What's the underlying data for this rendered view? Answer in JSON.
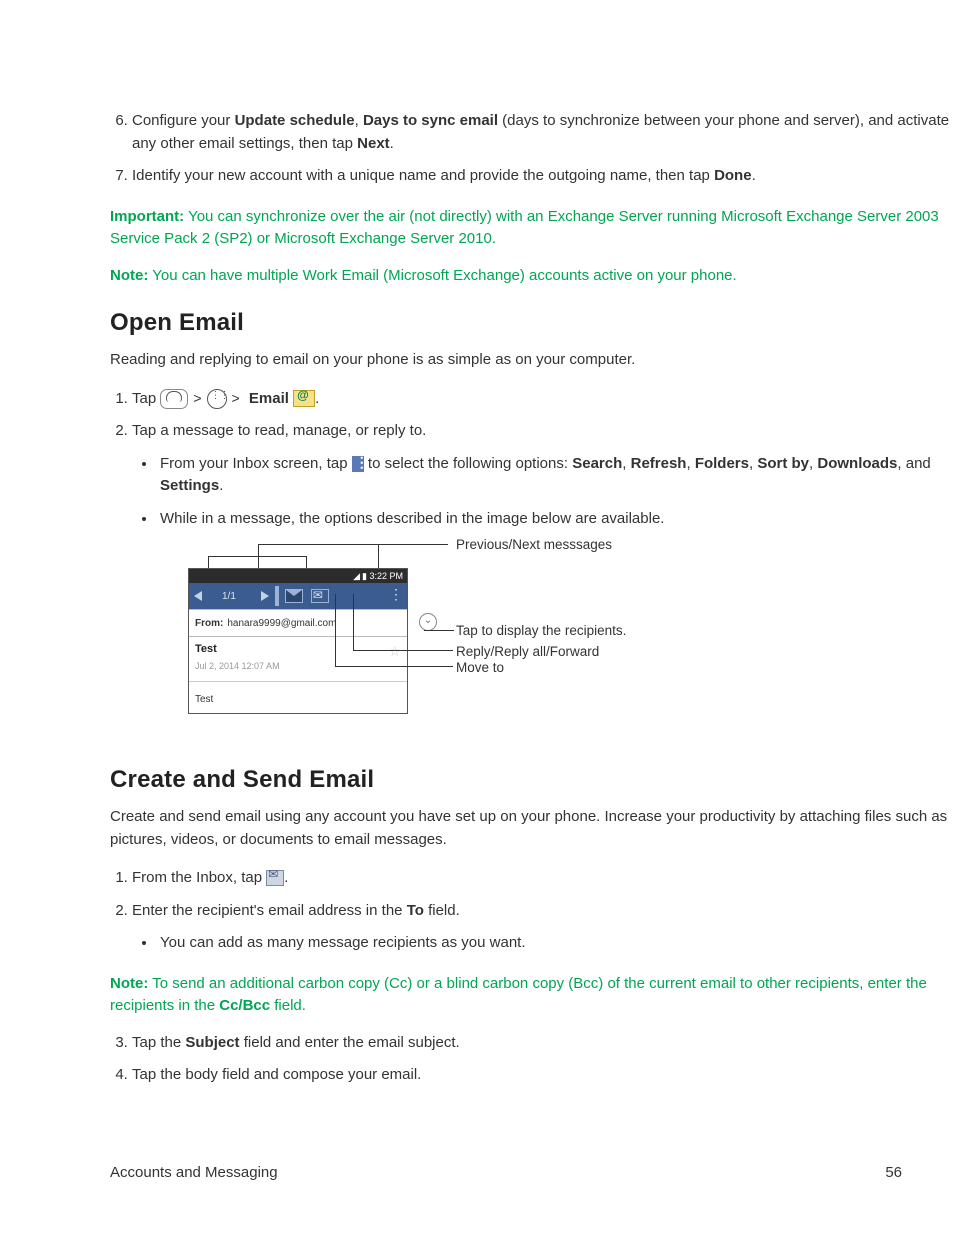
{
  "step6": {
    "prefix": "Configure your ",
    "b1": "Update schedule",
    "mid1": ", ",
    "b2": "Days to sync email",
    "mid2": " (days to synchronize between your phone and server), and activate any other email settings, then tap ",
    "b3": "Next",
    "suffix": "."
  },
  "step7": {
    "text_before": "Identify your new account with a unique name and provide the outgoing name, then tap ",
    "b1": "Done",
    "suffix": "."
  },
  "important": {
    "label": "Important:",
    "text": " You can synchronize over the air (not directly) with an Exchange Server running Microsoft Exchange Server 2003 Service Pack 2 (SP2) or Microsoft Exchange Server 2010."
  },
  "note1": {
    "label": "Note:",
    "text": " You can have multiple Work Email (Microsoft Exchange) accounts active on your phone."
  },
  "section_open": "Open Email",
  "open_lead": "Reading and replying to email on your phone is as simple as on your computer.",
  "open_step1": {
    "tap": "Tap ",
    "email_label": "Email",
    "period": "."
  },
  "open_step2": {
    "text": "Tap a message to read, manage, or reply to.",
    "bullet1_pre": "From your Inbox screen, tap ",
    "bullet1_mid": " to select the following options: ",
    "opt1": "Search",
    "opt2": "Refresh",
    "opt3": "Folders",
    "opt4": "Sort by",
    "opt5": "Downloads",
    "opt6": "Settings",
    "bullet1_and": ", and ",
    "bullet1_end": ".",
    "bullet2": "While in a message, the options described in the image below are available."
  },
  "diagram": {
    "callout_prevnext": "Previous/Next messsages",
    "callout_recipients": "Tap to display the recipients.",
    "callout_reply": "Reply/Reply all/Forward",
    "callout_move": "Move to",
    "time": "3:22 PM",
    "pager": "1/1",
    "from_label": "From:",
    "from_value": "hanara9999@gmail.com",
    "subject": "Test",
    "date": "Jul 2, 2014 12:07 AM",
    "body": "Test"
  },
  "section_create": "Create and Send Email",
  "create_lead": "Create and send email using any account you have set up on your phone. Increase your productivity by attaching files such as pictures, videos, or documents to email messages.",
  "create_step1_pre": "From the Inbox, tap ",
  "create_step1_end": ".",
  "create_step2": {
    "pre": "Enter the recipient's email address in the ",
    "b": "To",
    "post": " field.",
    "bullet": "You can add as many message recipients as you want."
  },
  "note2": {
    "label": "Note:",
    "pre": " To send an additional carbon copy (Cc) or a blind carbon copy (Bcc) of the current email to other recipients, enter the recipients in the ",
    "b": "Cc/Bcc",
    "post": " field."
  },
  "create_step3": {
    "pre": "Tap the ",
    "b": "Subject",
    "post": " field and enter the email subject."
  },
  "create_step4": "Tap the body field and compose your email.",
  "footer_left": "Accounts and Messaging",
  "footer_right": "56"
}
